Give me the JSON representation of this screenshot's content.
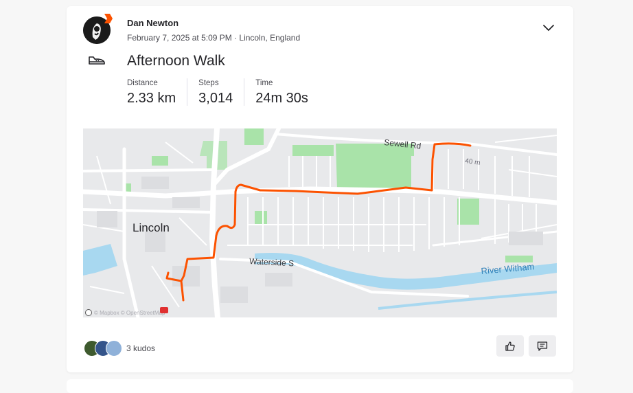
{
  "athlete": {
    "name": "Dan Newton"
  },
  "activity": {
    "meta": "February 7, 2025 at 5:09 PM · Lincoln, England",
    "type_icon": "walking-shoe-icon",
    "title": "Afternoon Walk",
    "stats": [
      {
        "label": "Distance",
        "value": "2.33 km"
      },
      {
        "label": "Steps",
        "value": "3,014"
      },
      {
        "label": "Time",
        "value": "24m 30s"
      }
    ]
  },
  "map": {
    "labels": {
      "city": "Lincoln",
      "road_north": "Sewell Rd",
      "road_south": "Waterside S",
      "river": "River Witham",
      "elevation": "40 m",
      "attribution": "© Mapbox © OpenStreetMap"
    },
    "route_color": "#fc5200",
    "water_color": "#a8d8f0",
    "park_color": "#a9e3a9"
  },
  "social": {
    "kudos_label": "3 kudos",
    "kudos_avatar_colors": [
      "#3e5a2e",
      "#34548a",
      "#8fb1d9"
    ]
  },
  "actions": {
    "kudos_icon": "thumbs-up-icon",
    "comment_icon": "comment-icon"
  },
  "colors": {
    "accent": "#fc5200"
  }
}
